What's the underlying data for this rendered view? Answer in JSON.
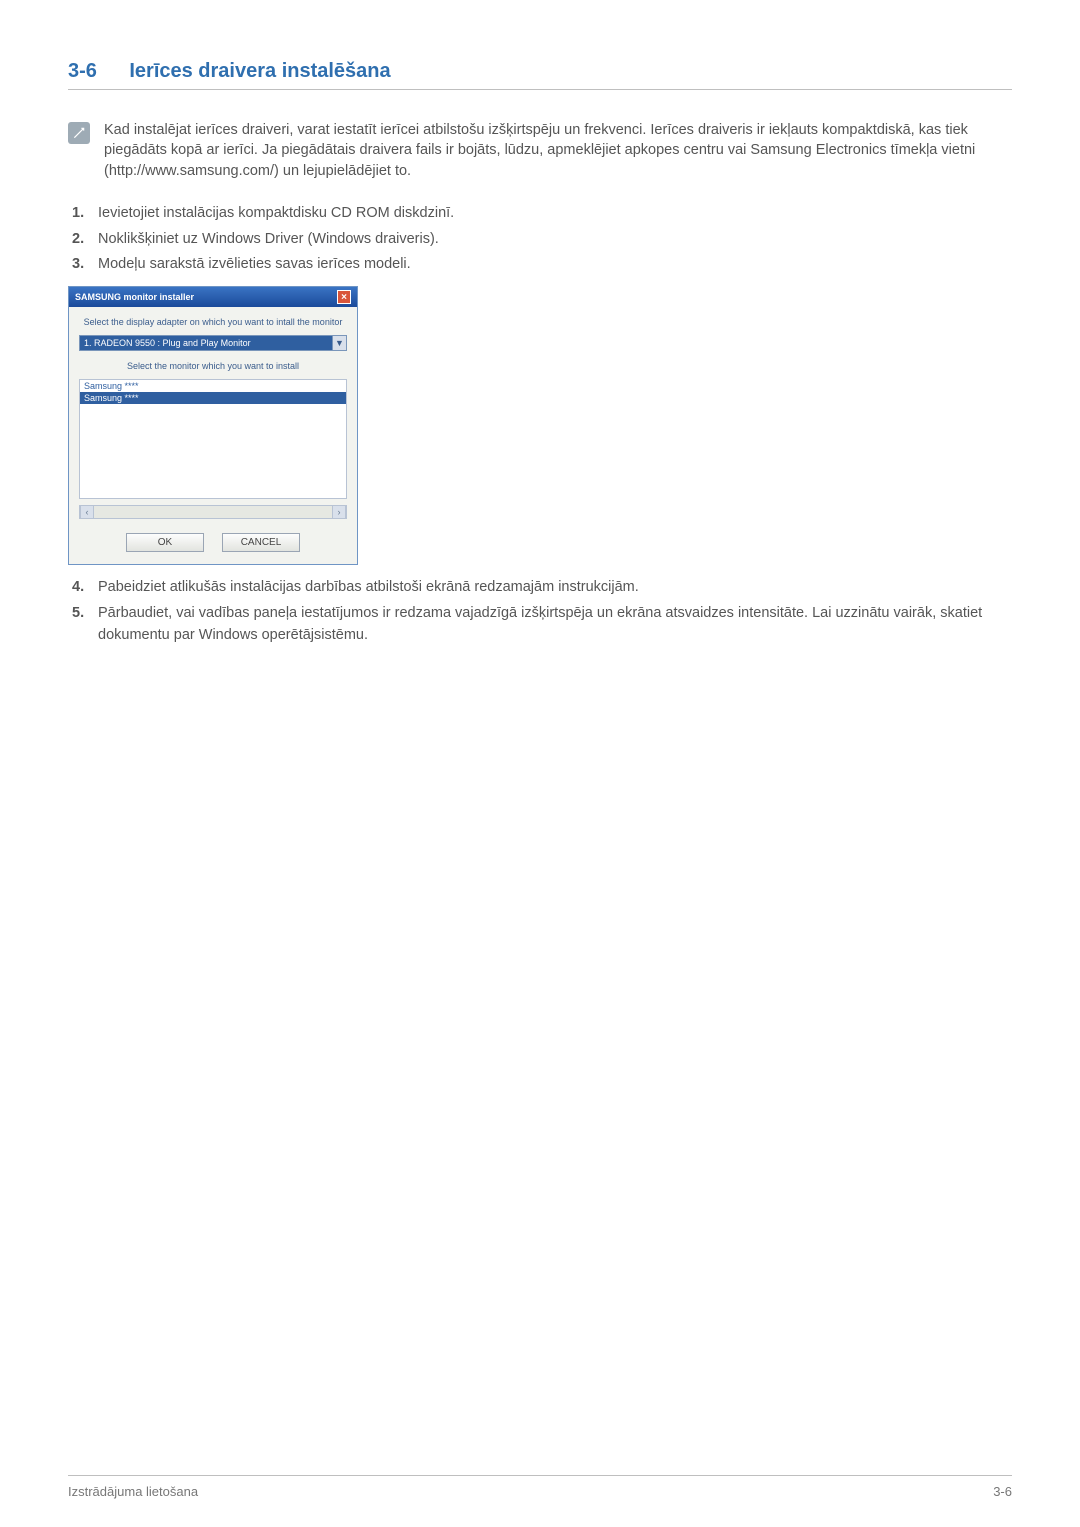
{
  "heading": {
    "num": "3-6",
    "title": "Ierīces draivera instalēšana"
  },
  "note": {
    "icon": "note-icon",
    "text": "Kad instalējat ierīces draiveri, varat iestatīt ierīcei atbilstošu izšķirtspēju un frekvenci. Ierīces draiveris ir iekļauts kompaktdiskā, kas tiek piegādāts kopā ar ierīci. Ja piegādātais draivera fails ir bojāts, lūdzu, apmeklējiet apkopes centru vai Samsung Electronics tīmekļa vietni (http://www.samsung.com/) un lejupielādējiet to."
  },
  "steps_a": [
    "Ievietojiet instalācijas kompaktdisku CD ROM diskdzinī.",
    "Noklikšķiniet uz Windows Driver (Windows draiveris).",
    "Modeļu sarakstā izvēlieties savas ierīces modeli."
  ],
  "dialog": {
    "title": "SAMSUNG monitor installer",
    "close": "×",
    "label_adapter": "Select the display adapter on which you want to intall the monitor",
    "adapter_value": "1. RADEON 9550 : Plug and Play Monitor",
    "label_monitor": "Select the monitor which you want to install",
    "list": [
      "Samsung ****",
      "Samsung ****"
    ],
    "ok": "OK",
    "cancel": "CANCEL"
  },
  "steps_b": [
    "Pabeidziet atlikušās instalācijas darbības atbilstoši ekrānā redzamajām instrukcijām.",
    "Pārbaudiet, vai vadības paneļa iestatījumos ir redzama vajadzīgā izšķirtspēja un ekrāna atsvaidzes intensitāte. Lai uzzinātu vairāk, skatiet dokumentu par Windows operētājsistēmu."
  ],
  "footer": {
    "left": "Izstrādājuma lietošana",
    "right": "3-6"
  }
}
